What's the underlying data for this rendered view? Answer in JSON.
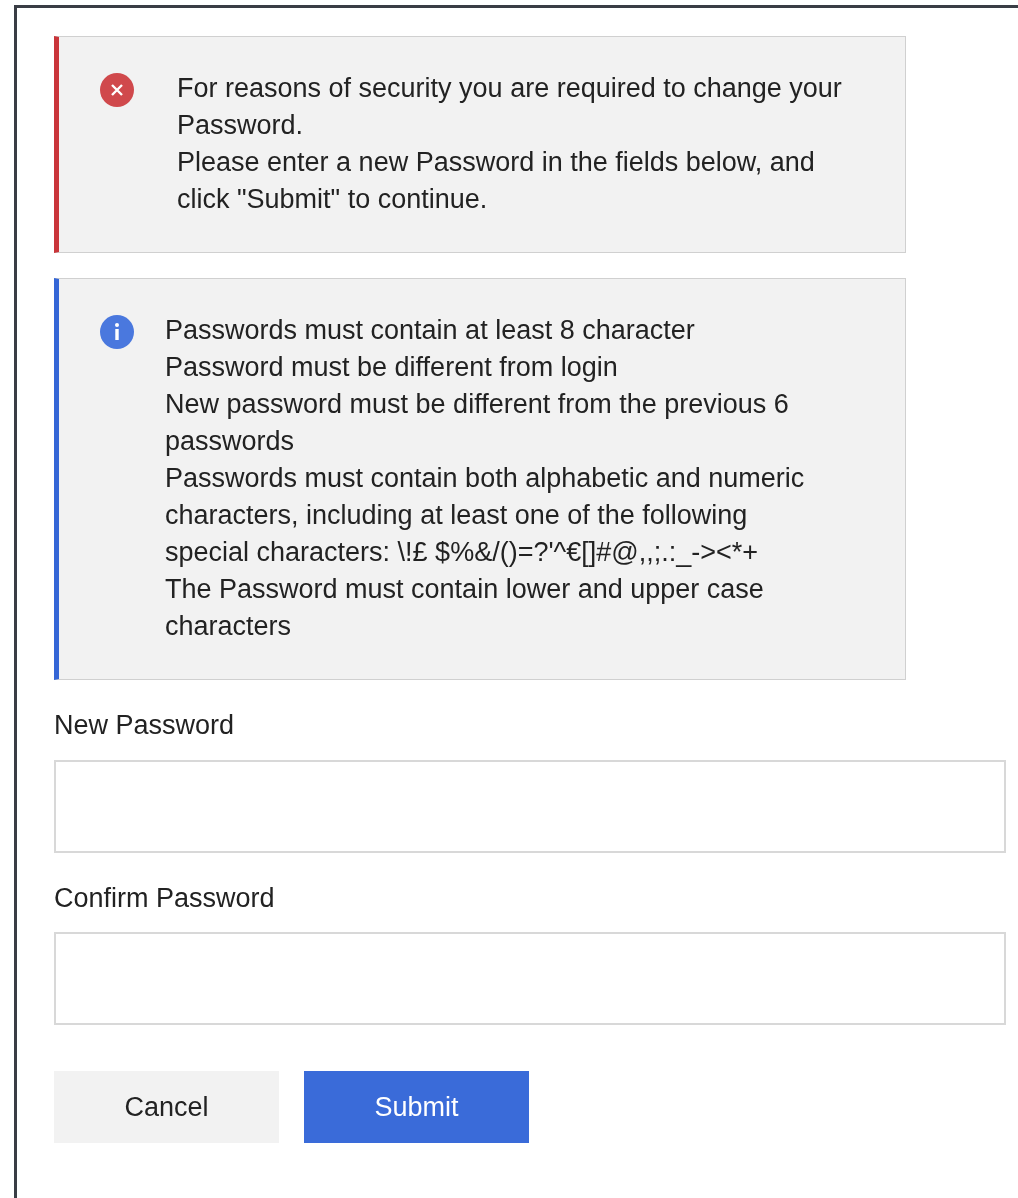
{
  "alerts": [
    {
      "kind": "error",
      "lines": [
        "For reasons of security you are required to change your Password.",
        "Please enter a new Password in the fields below, and click \"Submit\" to continue."
      ]
    },
    {
      "kind": "info",
      "lines": [
        "Passwords must contain at least 8 character",
        "Password must be different from login",
        "New password must be different from the previous 6 passwords",
        "Passwords must contain both alphabetic and numeric characters, including at least one of the following special characters: \\!£ $%&/()=?'^€[]#@,,;.:_-><*+",
        "The Password must contain lower and upper case characters"
      ]
    }
  ],
  "fields": [
    {
      "label": "New Password"
    },
    {
      "label": "Confirm Password"
    }
  ],
  "buttons": [
    {
      "label": "Cancel",
      "kind": "secondary"
    },
    {
      "label": "Submit",
      "kind": "primary"
    }
  ]
}
